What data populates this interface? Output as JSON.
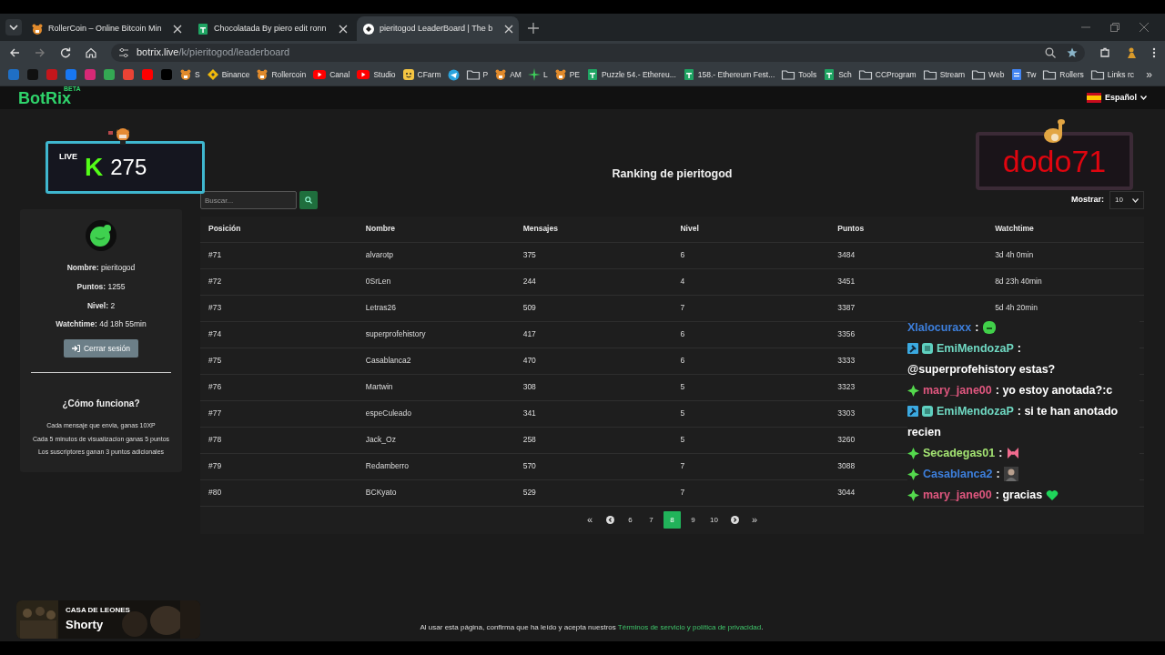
{
  "browser": {
    "tabs": [
      {
        "title": "RollerCoin – Online Bitcoin Min",
        "selected": false
      },
      {
        "title": "Chocolatada By piero edit ronn",
        "selected": false
      },
      {
        "title": "pieritogod LeaderBoard | The b",
        "selected": true
      }
    ],
    "address": {
      "host": "botrix.live",
      "path": "/k/pieritogod/leaderboard"
    },
    "bookmarks": [
      "S",
      "Binance",
      "Rollercoin",
      "Canal",
      "Studio",
      "CFarm",
      "P",
      "AM",
      "L",
      "PE",
      "Puzzle 54.- Ethereu...",
      "158.- Ethereum Fest...",
      "Tools",
      "Sch",
      "CCProgram",
      "Stream",
      "Web",
      "Tw",
      "Rollers",
      "Links rc"
    ],
    "more": "»"
  },
  "site": {
    "logo": "BotRix",
    "beta": "BETA",
    "language": "Español"
  },
  "live_widget": {
    "badge": "LIVE",
    "logo": "K",
    "viewers": "275"
  },
  "name_widget": {
    "name": "dodo71"
  },
  "profile": {
    "fields": [
      {
        "label": "Nombre:",
        "value": "pieritogod"
      },
      {
        "label": "Puntos:",
        "value": "1255"
      },
      {
        "label": "Nivel:",
        "value": "2"
      },
      {
        "label": "Watchtime:",
        "value": "4d 18h 55min"
      }
    ],
    "logout": "Cerrar sesión",
    "howto_title": "¿Cómo funciona?",
    "howto_lines": [
      "Cada mensaje que envia, ganas 10XP",
      "Cada 5 minutos de visualizacion ganas 5 puntos",
      "Los suscriptores ganan 3 puntos adicionales"
    ]
  },
  "ranking": {
    "title": "Ranking de pieritogod",
    "search_placeholder": "Buscar...",
    "show_label": "Mostrar:",
    "show_value": "10"
  },
  "table": {
    "columns": [
      "Posición",
      "Nombre",
      "Mensajes",
      "Nivel",
      "Puntos",
      "Watchtime"
    ],
    "rows": [
      [
        "#71",
        "alvarotp",
        "375",
        "6",
        "3484",
        "3d 4h 0min"
      ],
      [
        "#72",
        "0SrLen",
        "244",
        "4",
        "3451",
        "8d 23h 40min"
      ],
      [
        "#73",
        "Letras26",
        "509",
        "7",
        "3387",
        "5d 4h 20min"
      ],
      [
        "#74",
        "superprofehistory",
        "417",
        "6",
        "3356"
      ],
      [
        "#75",
        "Casablanca2",
        "470",
        "6",
        "3333"
      ],
      [
        "#76",
        "Martwin",
        "308",
        "5",
        "3323"
      ],
      [
        "#77",
        "espeCuleado",
        "341",
        "5",
        "3303"
      ],
      [
        "#78",
        "Jack_Oz",
        "258",
        "5",
        "3260"
      ],
      [
        "#79",
        "Redamberro",
        "570",
        "7",
        "3088"
      ],
      [
        "#80",
        "BCKyato",
        "529",
        "7",
        "3044"
      ]
    ]
  },
  "pagination": [
    {
      "kind": "text",
      "label": "«"
    },
    {
      "kind": "prev"
    },
    {
      "kind": "page",
      "label": "6",
      "selected": false
    },
    {
      "kind": "page",
      "label": "7",
      "selected": false
    },
    {
      "kind": "page",
      "label": "8",
      "selected": true
    },
    {
      "kind": "page",
      "label": "9",
      "selected": false
    },
    {
      "kind": "page",
      "label": "10",
      "selected": false
    },
    {
      "kind": "next"
    },
    {
      "kind": "text",
      "label": "»"
    }
  ],
  "chat": [
    {
      "user": "Xlalocuraxx",
      "color": "#3d7fdc",
      "text": ":"
    },
    {
      "user": "EmiMendozaP",
      "color": "#6fd8c2",
      "text": ":",
      "text_2": "@superprofehistory estas?"
    },
    {
      "user": "mary_jane00",
      "color": "#e0577f",
      "text": ": yo estoy anotada?:c"
    },
    {
      "user": "EmiMendozaP",
      "color": "#6fd8c2",
      "text": ": si te han anotado",
      "text_2": "recien"
    },
    {
      "user": "Secadegas01",
      "color": "#a3e372",
      "text": ":"
    },
    {
      "user": "Casablanca2",
      "color": "#3d7fdc",
      "text": ":"
    },
    {
      "user": "mary_jane00",
      "color": "#e0577f",
      "text": ": gracias"
    }
  ],
  "now_playing": {
    "artist": "CASA DE LEONES",
    "track": "Shorty"
  },
  "footer": {
    "text": "Al usar esta página, confirma que ha leído y acepta nuestros ",
    "link": "Términos de servicio y política de privacidad",
    "end": "."
  }
}
